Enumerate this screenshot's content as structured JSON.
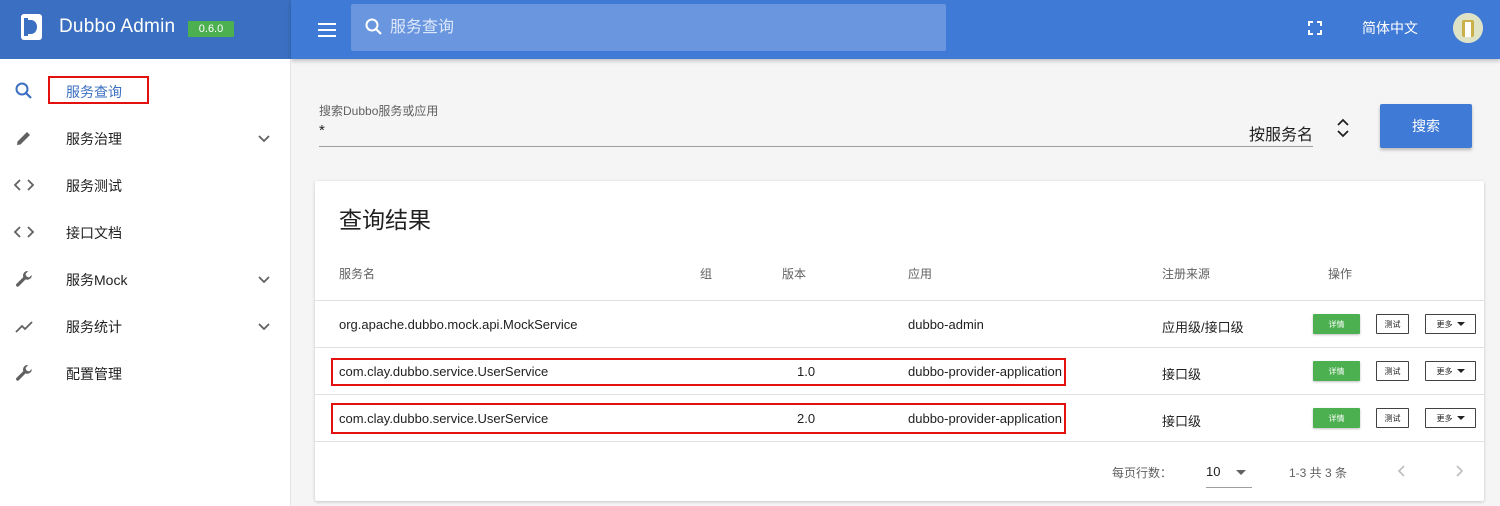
{
  "brand": {
    "title": "Dubbo Admin",
    "version": "0.6.0"
  },
  "header": {
    "search_placeholder": "服务查询",
    "language": "简体中文",
    "colors": {
      "brand_bg": "#3b6fc1",
      "appbar_bg": "#3f7ad6",
      "version_badge": "#4caf50"
    }
  },
  "sidebar": {
    "items": [
      {
        "label": "服务查询",
        "icon": "search-icon",
        "active": true,
        "expandable": false
      },
      {
        "label": "服务治理",
        "icon": "pencil-icon",
        "active": false,
        "expandable": true
      },
      {
        "label": "服务测试",
        "icon": "code-icon",
        "active": false,
        "expandable": false
      },
      {
        "label": "接口文档",
        "icon": "code-icon",
        "active": false,
        "expandable": false
      },
      {
        "label": "服务Mock",
        "icon": "wrench-icon",
        "active": false,
        "expandable": true
      },
      {
        "label": "服务统计",
        "icon": "trending-icon",
        "active": false,
        "expandable": true
      },
      {
        "label": "配置管理",
        "icon": "wrench-icon",
        "active": false,
        "expandable": false
      }
    ]
  },
  "search": {
    "field_label": "搜索Dubbo服务或应用",
    "value": "*",
    "mode": "按服务名",
    "button_label": "搜索"
  },
  "results": {
    "title": "查询结果",
    "columns": [
      "服务名",
      "组",
      "版本",
      "应用",
      "注册来源",
      "操作"
    ],
    "rows": [
      {
        "service": "org.apache.dubbo.mock.api.MockService",
        "group": "",
        "version": "",
        "app": "dubbo-admin",
        "source": "应用级/接口级"
      },
      {
        "service": "com.clay.dubbo.service.UserService",
        "group": "",
        "version": "1.0",
        "app": "dubbo-provider-application",
        "source": "接口级"
      },
      {
        "service": "com.clay.dubbo.service.UserService",
        "group": "",
        "version": "2.0",
        "app": "dubbo-provider-application",
        "source": "接口级"
      }
    ],
    "actions": {
      "detail": "详情",
      "test": "测试",
      "more": "更多"
    },
    "footer": {
      "rows_per_page_label": "每页行数：",
      "rows_per_page": "10",
      "range": "1-3 共 3 条"
    }
  }
}
